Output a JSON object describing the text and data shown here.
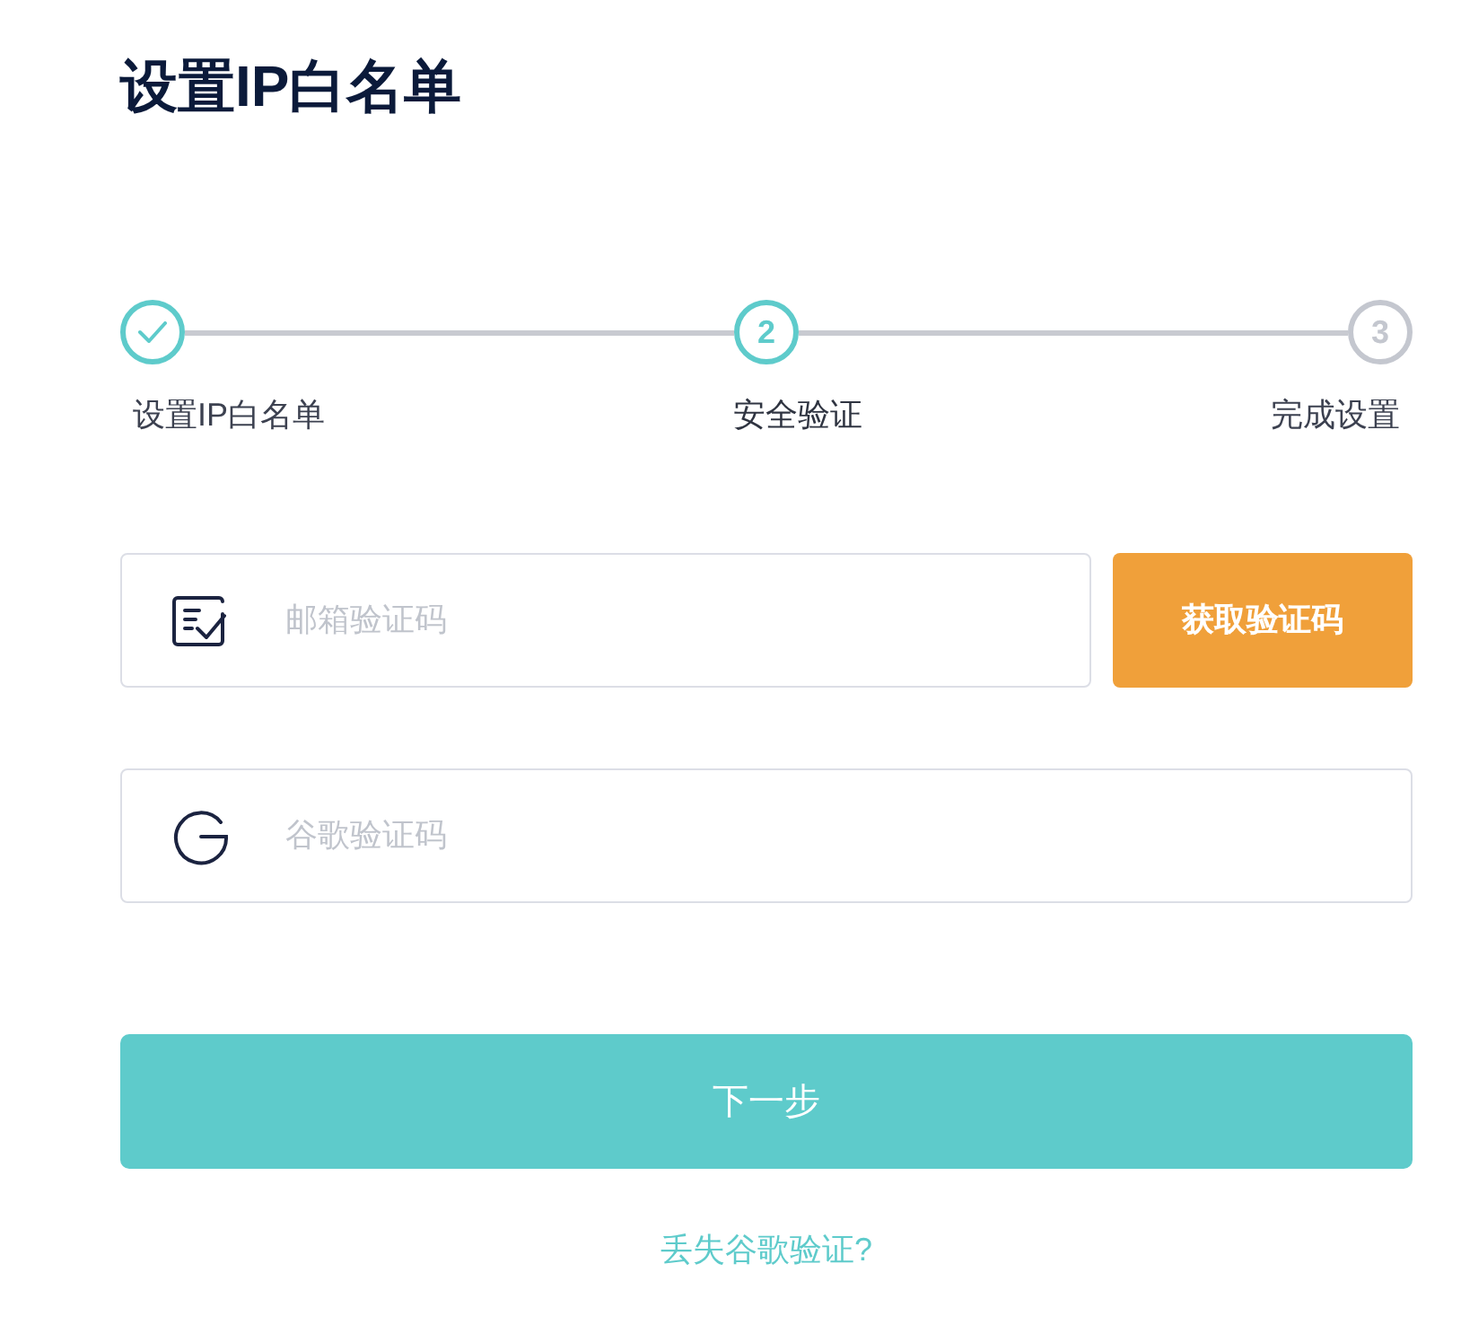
{
  "page": {
    "title": "设置IP白名单"
  },
  "steps": [
    {
      "label": "设置IP白名单",
      "completed": true,
      "selected": false
    },
    {
      "number": "2",
      "label": "安全验证",
      "completed": false,
      "selected": true
    },
    {
      "number": "3",
      "label": "完成设置",
      "completed": false,
      "selected": false
    }
  ],
  "fields": [
    {
      "kind": "email",
      "placeholder": "邮箱验证码",
      "button": "获取验证码"
    },
    {
      "kind": "google",
      "placeholder": "谷歌验证码"
    }
  ],
  "submit": "下一步",
  "link": "丢失谷歌验证?"
}
